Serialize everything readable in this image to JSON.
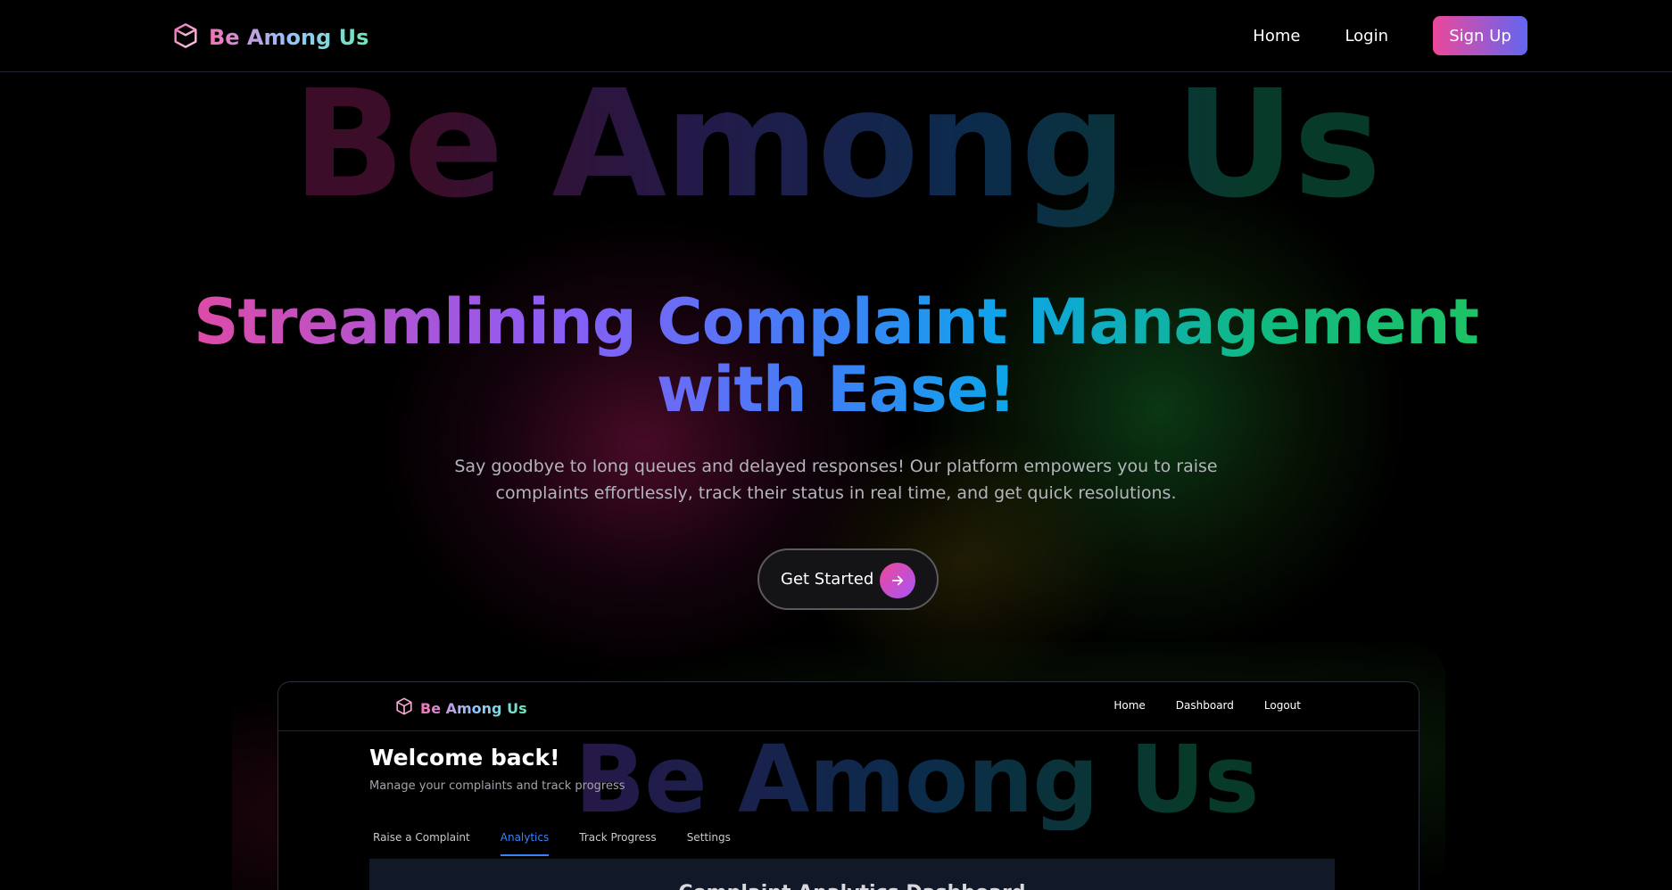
{
  "nav": {
    "brand": "Be Among Us",
    "links": [
      "Home",
      "Login"
    ],
    "signup_label": "Sign Up"
  },
  "hero": {
    "watermark": "Be Among Us",
    "title": "Streamlining Complaint Management with Ease!",
    "subtitle": "Say goodbye to long queues and delayed responses! Our platform empowers you to raise complaints effortlessly, track their status in real time, and get quick resolutions.",
    "cta_label": "Get Started"
  },
  "preview": {
    "brand": "Be Among Us",
    "links": [
      "Home",
      "Dashboard",
      "Logout"
    ],
    "watermark": "Be Among Us",
    "welcome": "Welcome back!",
    "manage": "Manage your complaints and track progress",
    "tabs": [
      "Raise a Complaint",
      "Analytics",
      "Track Progress",
      "Settings"
    ],
    "active_tab": "Analytics",
    "panel_title": "Complaint Analytics Dashboard"
  },
  "colors": {
    "accent_pink": "#ec4899",
    "accent_indigo": "#6366f1",
    "accent_blue": "#3b82f6",
    "accent_green": "#22c55e"
  },
  "icons": [
    "cube-icon",
    "arrow-right-icon"
  ]
}
